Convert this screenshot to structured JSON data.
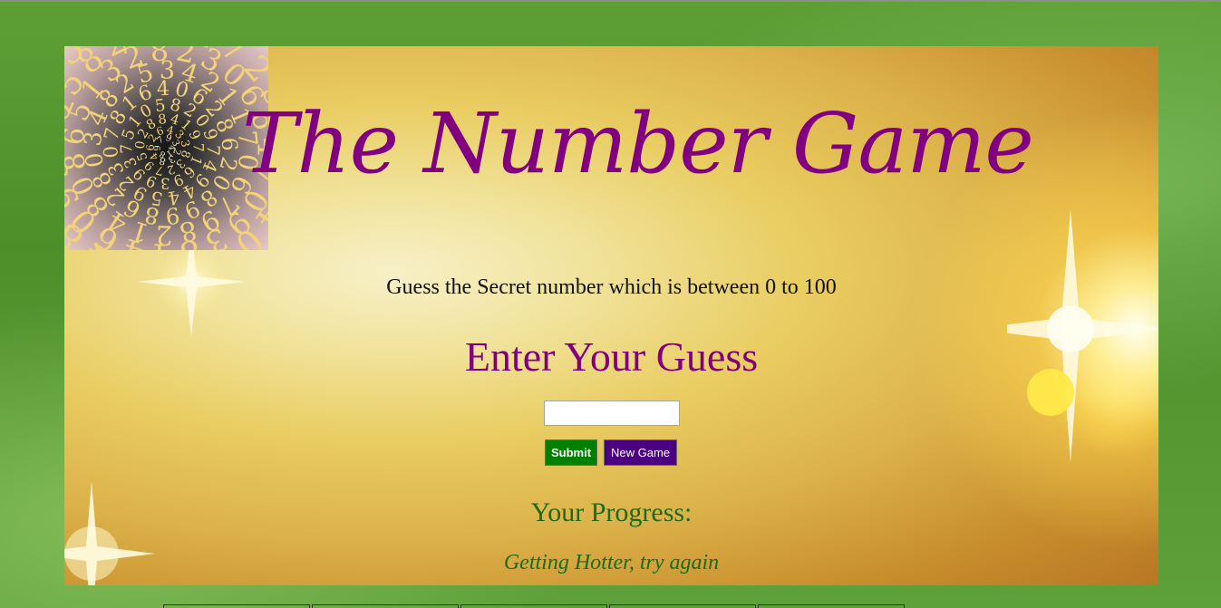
{
  "header": {
    "title": "The Number Game"
  },
  "logo": {
    "icon": "number-spiral-icon",
    "digits": "418979323846264338327950288419716939937510582097494459230781640628620899862803482534211706798214808651328230664709384460955058223172535940812848111745028410270193852110555964462294895493038196"
  },
  "game": {
    "instruction": "Guess the Secret number which is between 0 to 100",
    "enter_label": "Enter Your Guess",
    "guess_value": "",
    "submit_label": "Submit",
    "new_game_label": "New Game"
  },
  "progress": {
    "label": "Your Progress:",
    "status": "Getting Hotter, try again"
  },
  "colors": {
    "title": "#800080",
    "submit": "#008000",
    "new_game": "#4b0082",
    "progress": "#1a6b1a",
    "page_bg": "#5e9f35"
  }
}
